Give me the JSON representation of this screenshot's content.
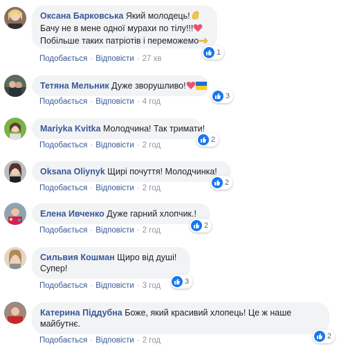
{
  "actions": {
    "like": "Подобається",
    "reply": "Відповісти",
    "separator": "·"
  },
  "colors": {
    "author": "#385898",
    "bubble": "#f2f3f5",
    "like_blue": "#1877f2"
  },
  "comments": [
    {
      "author": "Оксана Барковська",
      "lines": [
        "Який молодець!",
        "Бачу не в мене одної мурахи по тілу!!!",
        "Побільше таких патріотів і переможемо"
      ],
      "emojis": [
        "clap-hands-icon",
        "red-heart-icon",
        "pointing-hand-icon"
      ],
      "reactions": "1",
      "time": "27 хв"
    },
    {
      "author": "Тетяна Мельник",
      "lines": [
        "Дуже зворушливо!"
      ],
      "emojis": [
        "red-heart-icon",
        "ukraine-flag-icon"
      ],
      "reactions": "3",
      "time": "4 год"
    },
    {
      "author": "Mariyka Kvitka",
      "lines": [
        "Молодчина! Так тримати!"
      ],
      "reactions": "2",
      "time": "2 год"
    },
    {
      "author": "Oksana Oliynyk",
      "lines": [
        "Щирі почуття! Молодчинка!"
      ],
      "reactions": "2",
      "time": "2 год"
    },
    {
      "author": "Елена Ивченко",
      "lines": [
        "Дуже гарний хлопчик.!"
      ],
      "reactions": "2",
      "time": "2 год"
    },
    {
      "author": "Сильвия Кошман",
      "lines": [
        "Щиро від душі!",
        "Супер!"
      ],
      "reactions": "3",
      "time": "3 год"
    },
    {
      "author": "Катерина Піддубна",
      "lines": [
        "Боже, який красивий хлопець! Це ж наше",
        "майбутнє."
      ],
      "reactions": "2",
      "time": "2 год"
    }
  ]
}
